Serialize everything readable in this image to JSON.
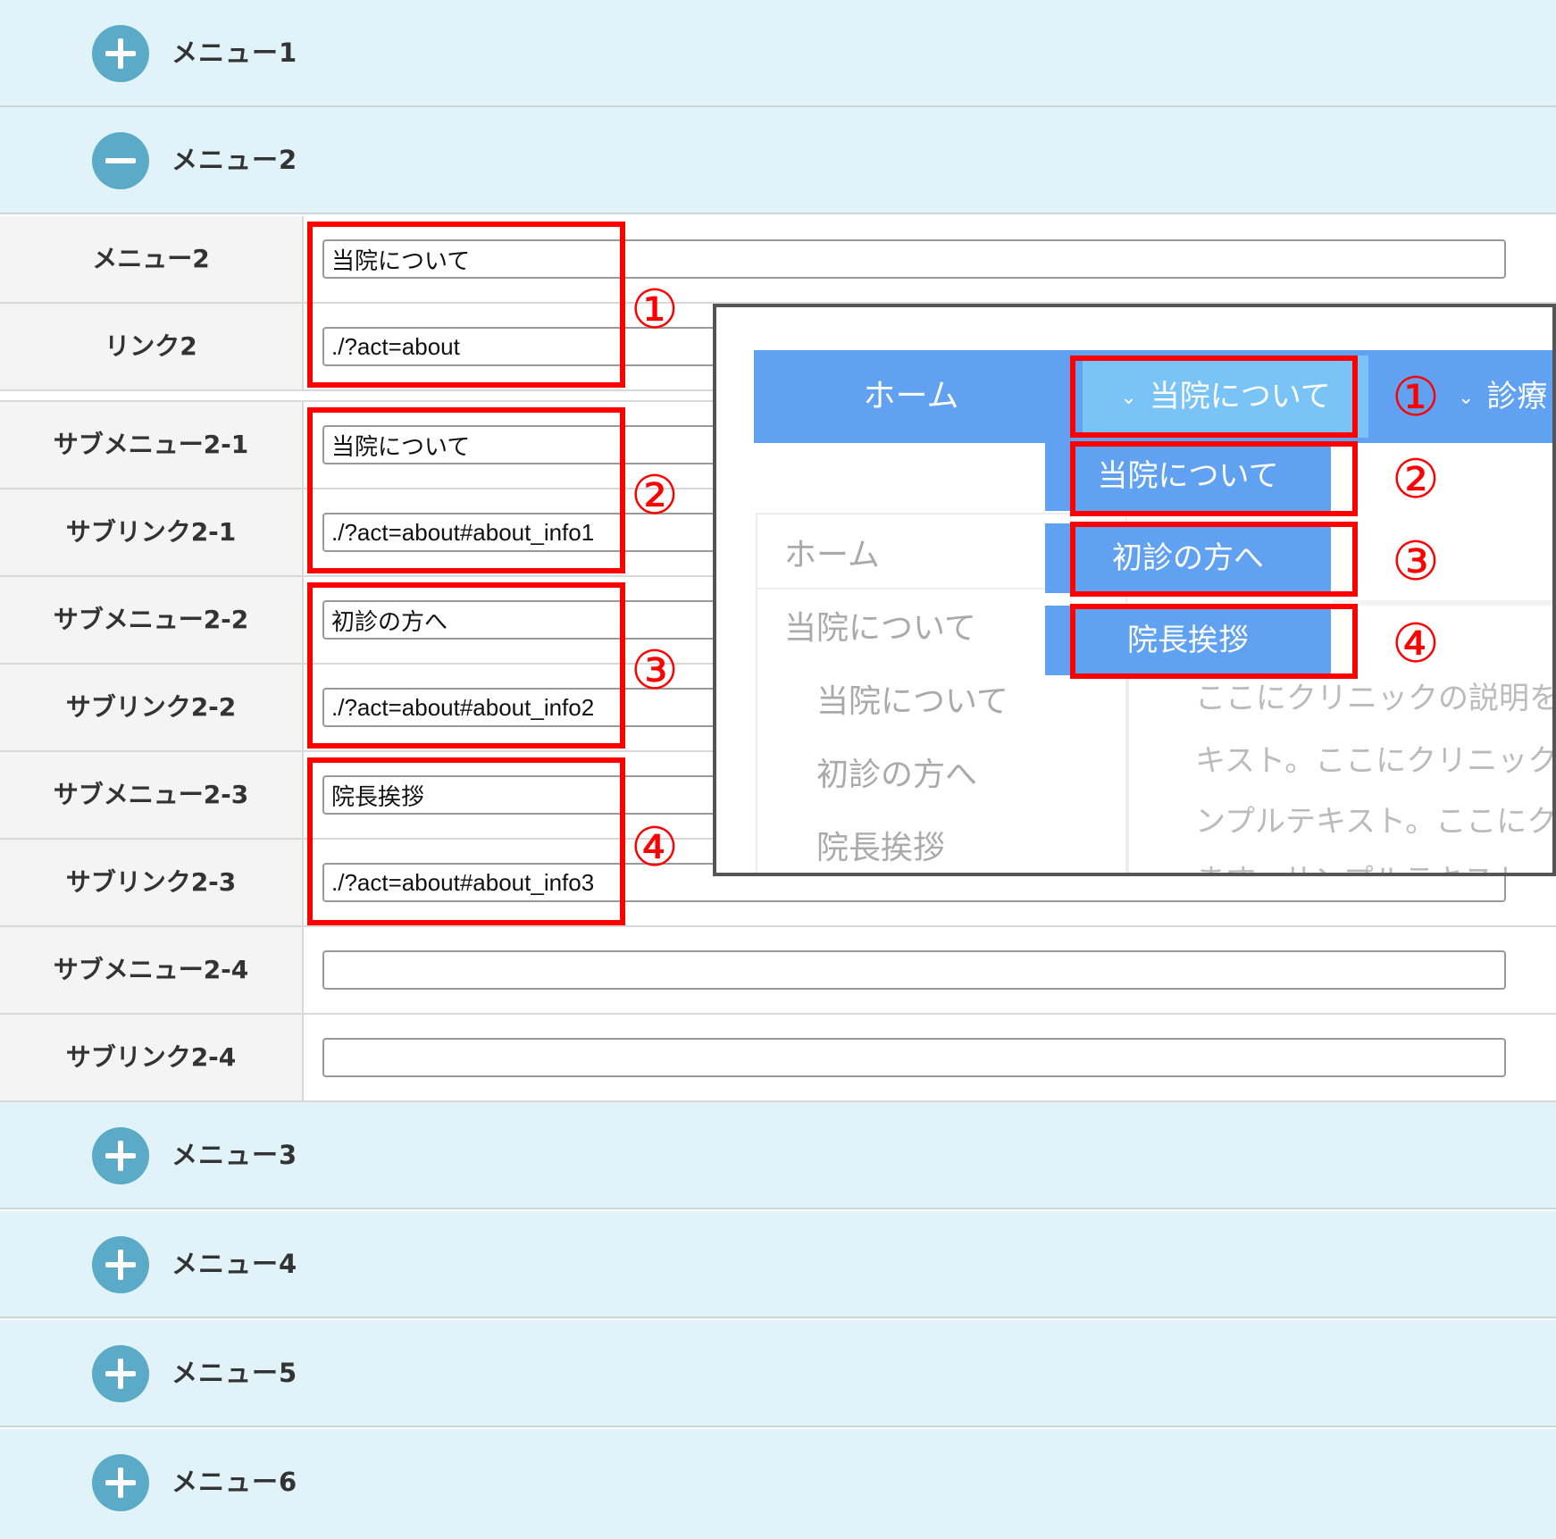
{
  "accordions": {
    "menu1": "メニュー1",
    "menu2": "メニュー2",
    "menu3": "メニュー3",
    "menu4": "メニュー4",
    "menu5": "メニュー5",
    "menu6": "メニュー6"
  },
  "form": {
    "rows": [
      {
        "label": "メニュー2",
        "value": "当院について"
      },
      {
        "label": "リンク2",
        "value": "./?act=about"
      },
      {
        "label": "サブメニュー2-1",
        "value": "当院について"
      },
      {
        "label": "サブリンク2-1",
        "value": "./?act=about#about_info1"
      },
      {
        "label": "サブメニュー2-2",
        "value": "初診の方へ"
      },
      {
        "label": "サブリンク2-2",
        "value": "./?act=about#about_info2"
      },
      {
        "label": "サブメニュー2-3",
        "value": "院長挨拶"
      },
      {
        "label": "サブリンク2-3",
        "value": "./?act=about#about_info3"
      },
      {
        "label": "サブメニュー2-4",
        "value": ""
      },
      {
        "label": "サブリンク2-4",
        "value": ""
      }
    ]
  },
  "annotations": [
    "①",
    "②",
    "③",
    "④"
  ],
  "preview": {
    "nav": {
      "home": "ホーム",
      "active": "当院について",
      "next": "診療"
    },
    "dropdown": [
      "当院について",
      "初診の方へ",
      "院長挨拶"
    ],
    "sidebar": [
      "ホーム",
      "当院について",
      "当院について",
      "初診の方へ",
      "院長挨拶"
    ],
    "body_lines": [
      "ここにクリニックの説明を",
      "キスト。ここにクリニック",
      "ンプルテキスト。ここにク",
      "ます。サンプルテキスト"
    ]
  },
  "colors": {
    "accordion_bg": "#e1f3f9",
    "icon_circle": "#5aaac8",
    "annotation_red": "#ff0000",
    "nav_blue": "#60a1f2",
    "nav_active": "#79c3f7"
  }
}
